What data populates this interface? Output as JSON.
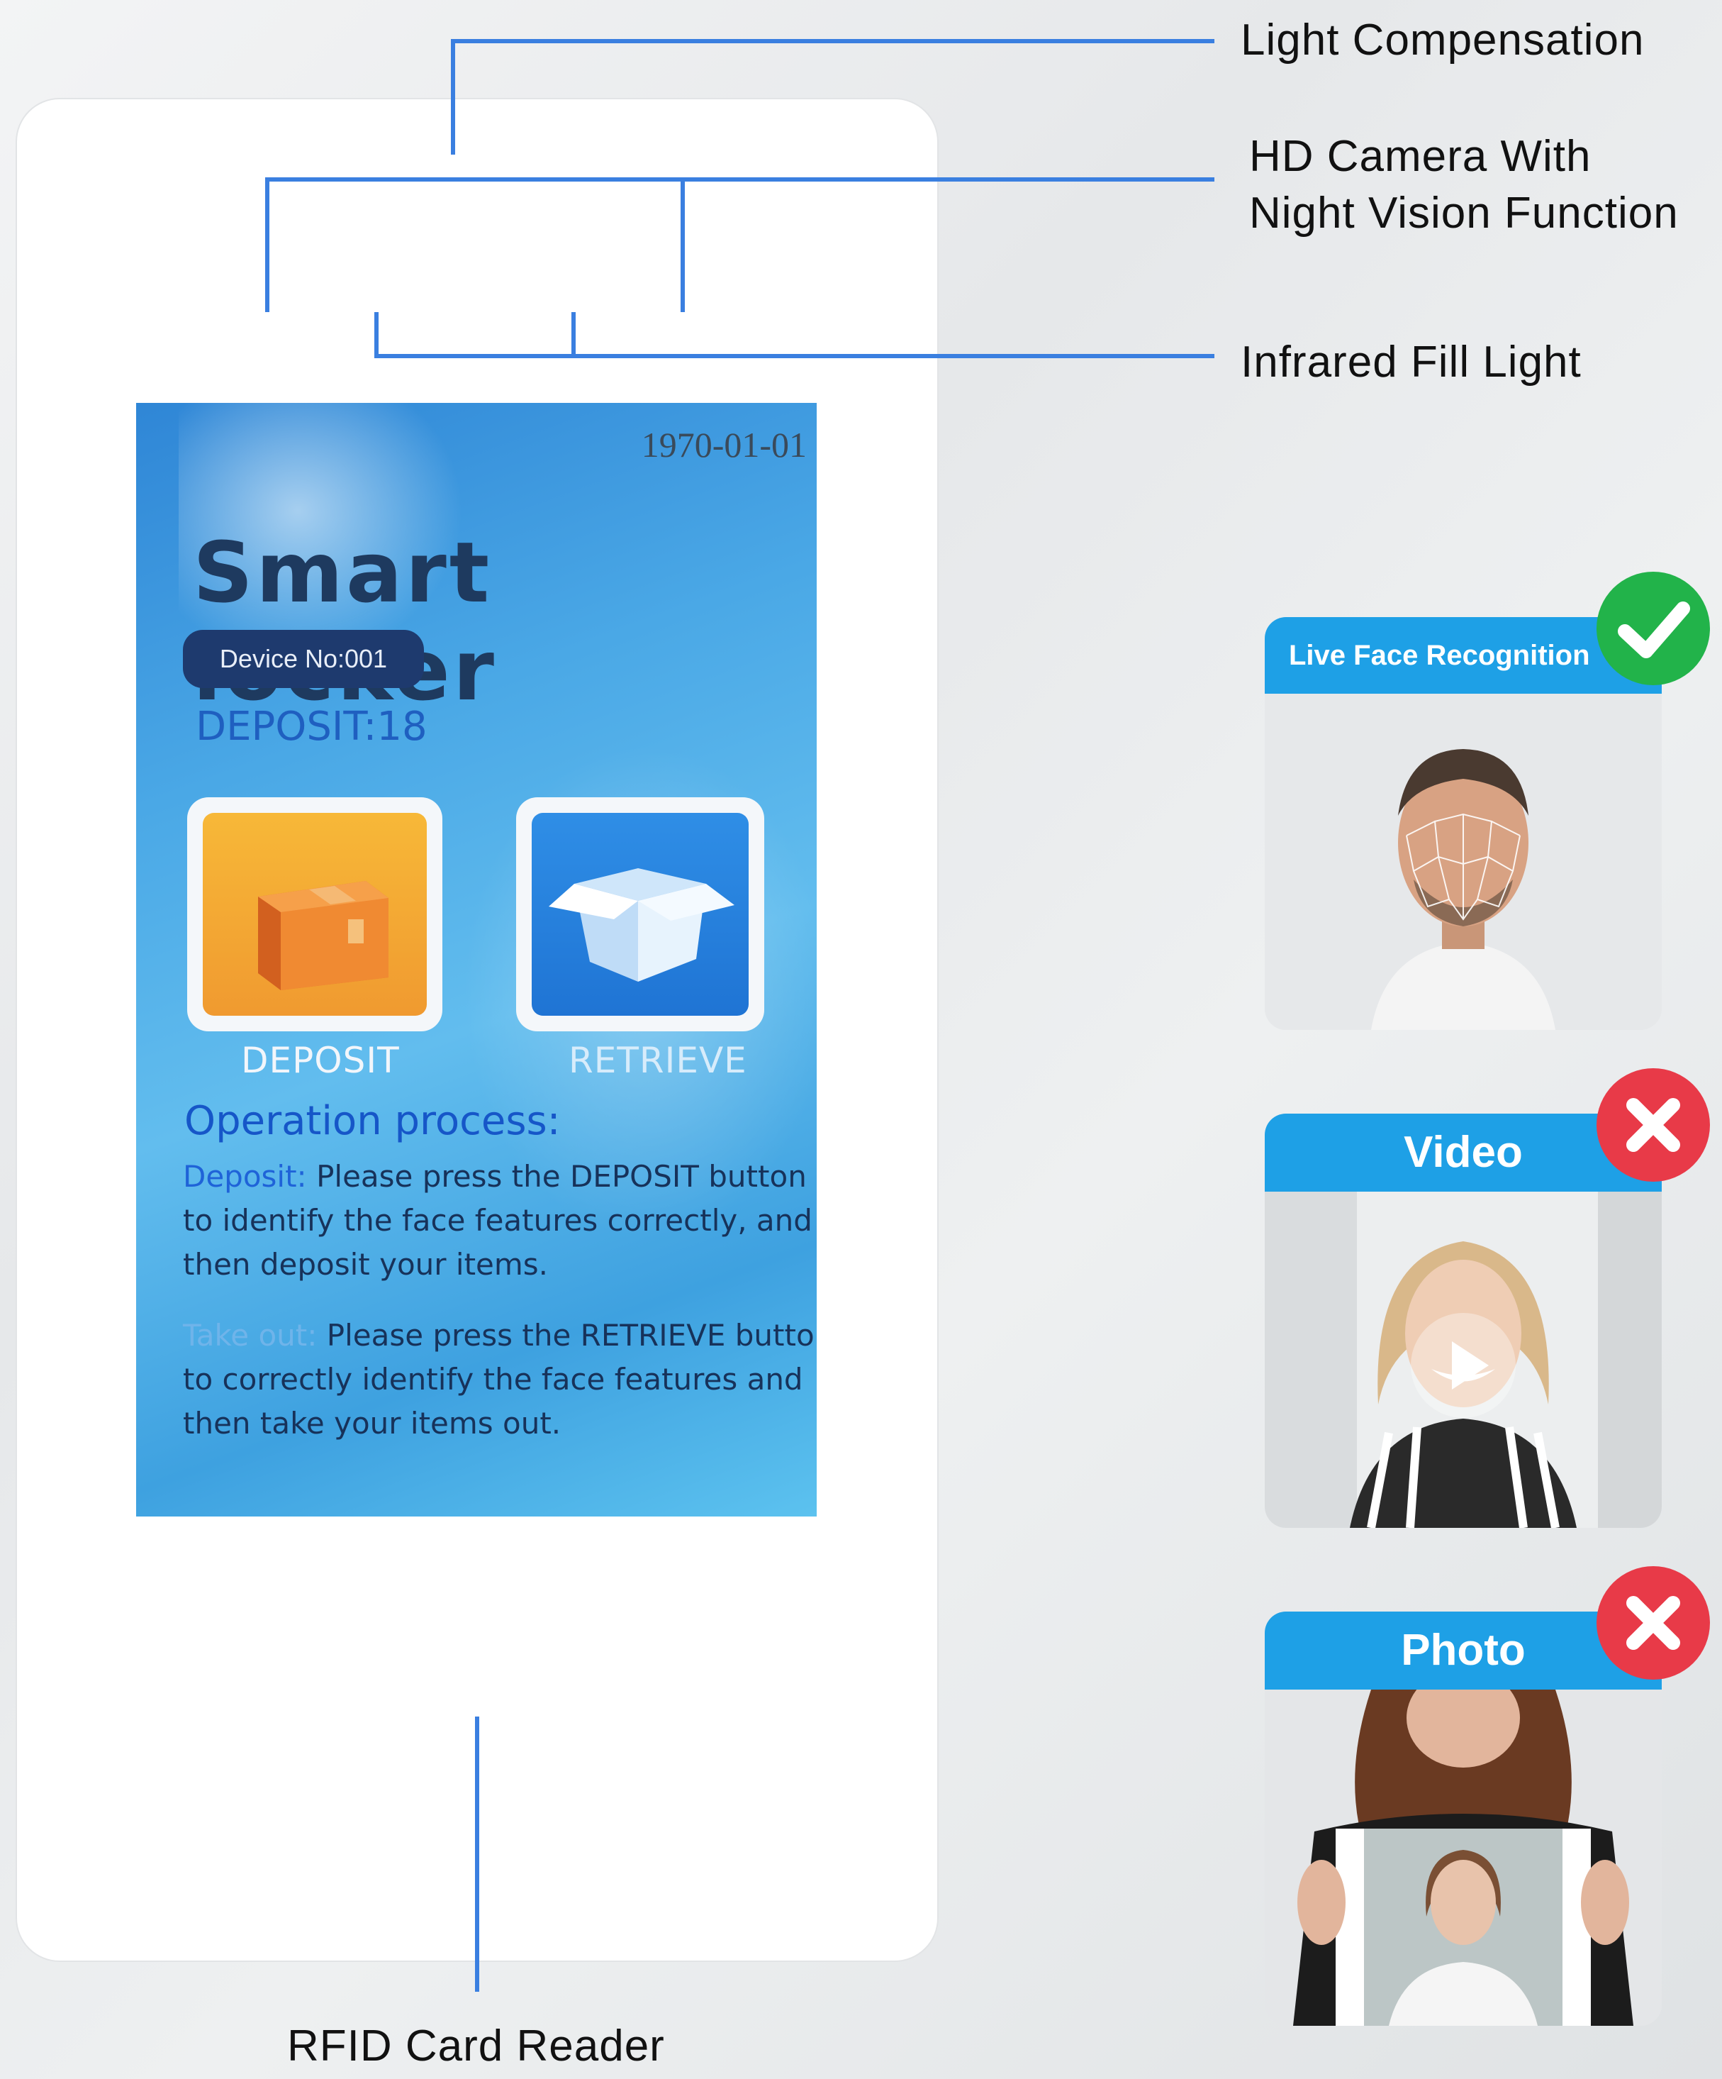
{
  "callouts": {
    "light_compensation": "Light Compensation",
    "hd_camera_line1": "HD Camera With",
    "hd_camera_line2": "Night Vision Function",
    "infrared": "Infrared Fill Light",
    "rfid": "RFID Card Reader"
  },
  "screen": {
    "date": "1970-01-01",
    "title": "Smart locker",
    "device_no": "Device No:001",
    "deposit_count": "DEPOSIT:18",
    "deposit_label": "DEPOSIT",
    "retrieve_label": "RETRIEVE",
    "operation_title": "Operation process:",
    "deposit_step_label": "Deposit:",
    "deposit_step_text": "Please press the DEPOSIT button\nto identify the face features correctly, and\nthen deposit your items.",
    "takeout_step_label": "Take out:",
    "takeout_step_text": "Please press the RETRIEVE butto\nto correctly identify the face features and\nthen take your items out."
  },
  "cards": {
    "live": {
      "title": "Live Face Recognition",
      "status": "accepted"
    },
    "video": {
      "title": "Video",
      "status": "rejected"
    },
    "photo": {
      "title": "Photo",
      "status": "rejected"
    }
  },
  "colors": {
    "accent_line": "#3a7fe0",
    "card_header": "#1ea0e6",
    "check_green": "#22b34a",
    "cross_red": "#e83a48"
  },
  "icons": {
    "deposit_tile": "closed-box-icon",
    "retrieve_tile": "open-box-icon",
    "live_badge": "check-icon",
    "video_badge": "cross-icon",
    "photo_badge": "cross-icon",
    "video_overlay": "play-icon"
  }
}
